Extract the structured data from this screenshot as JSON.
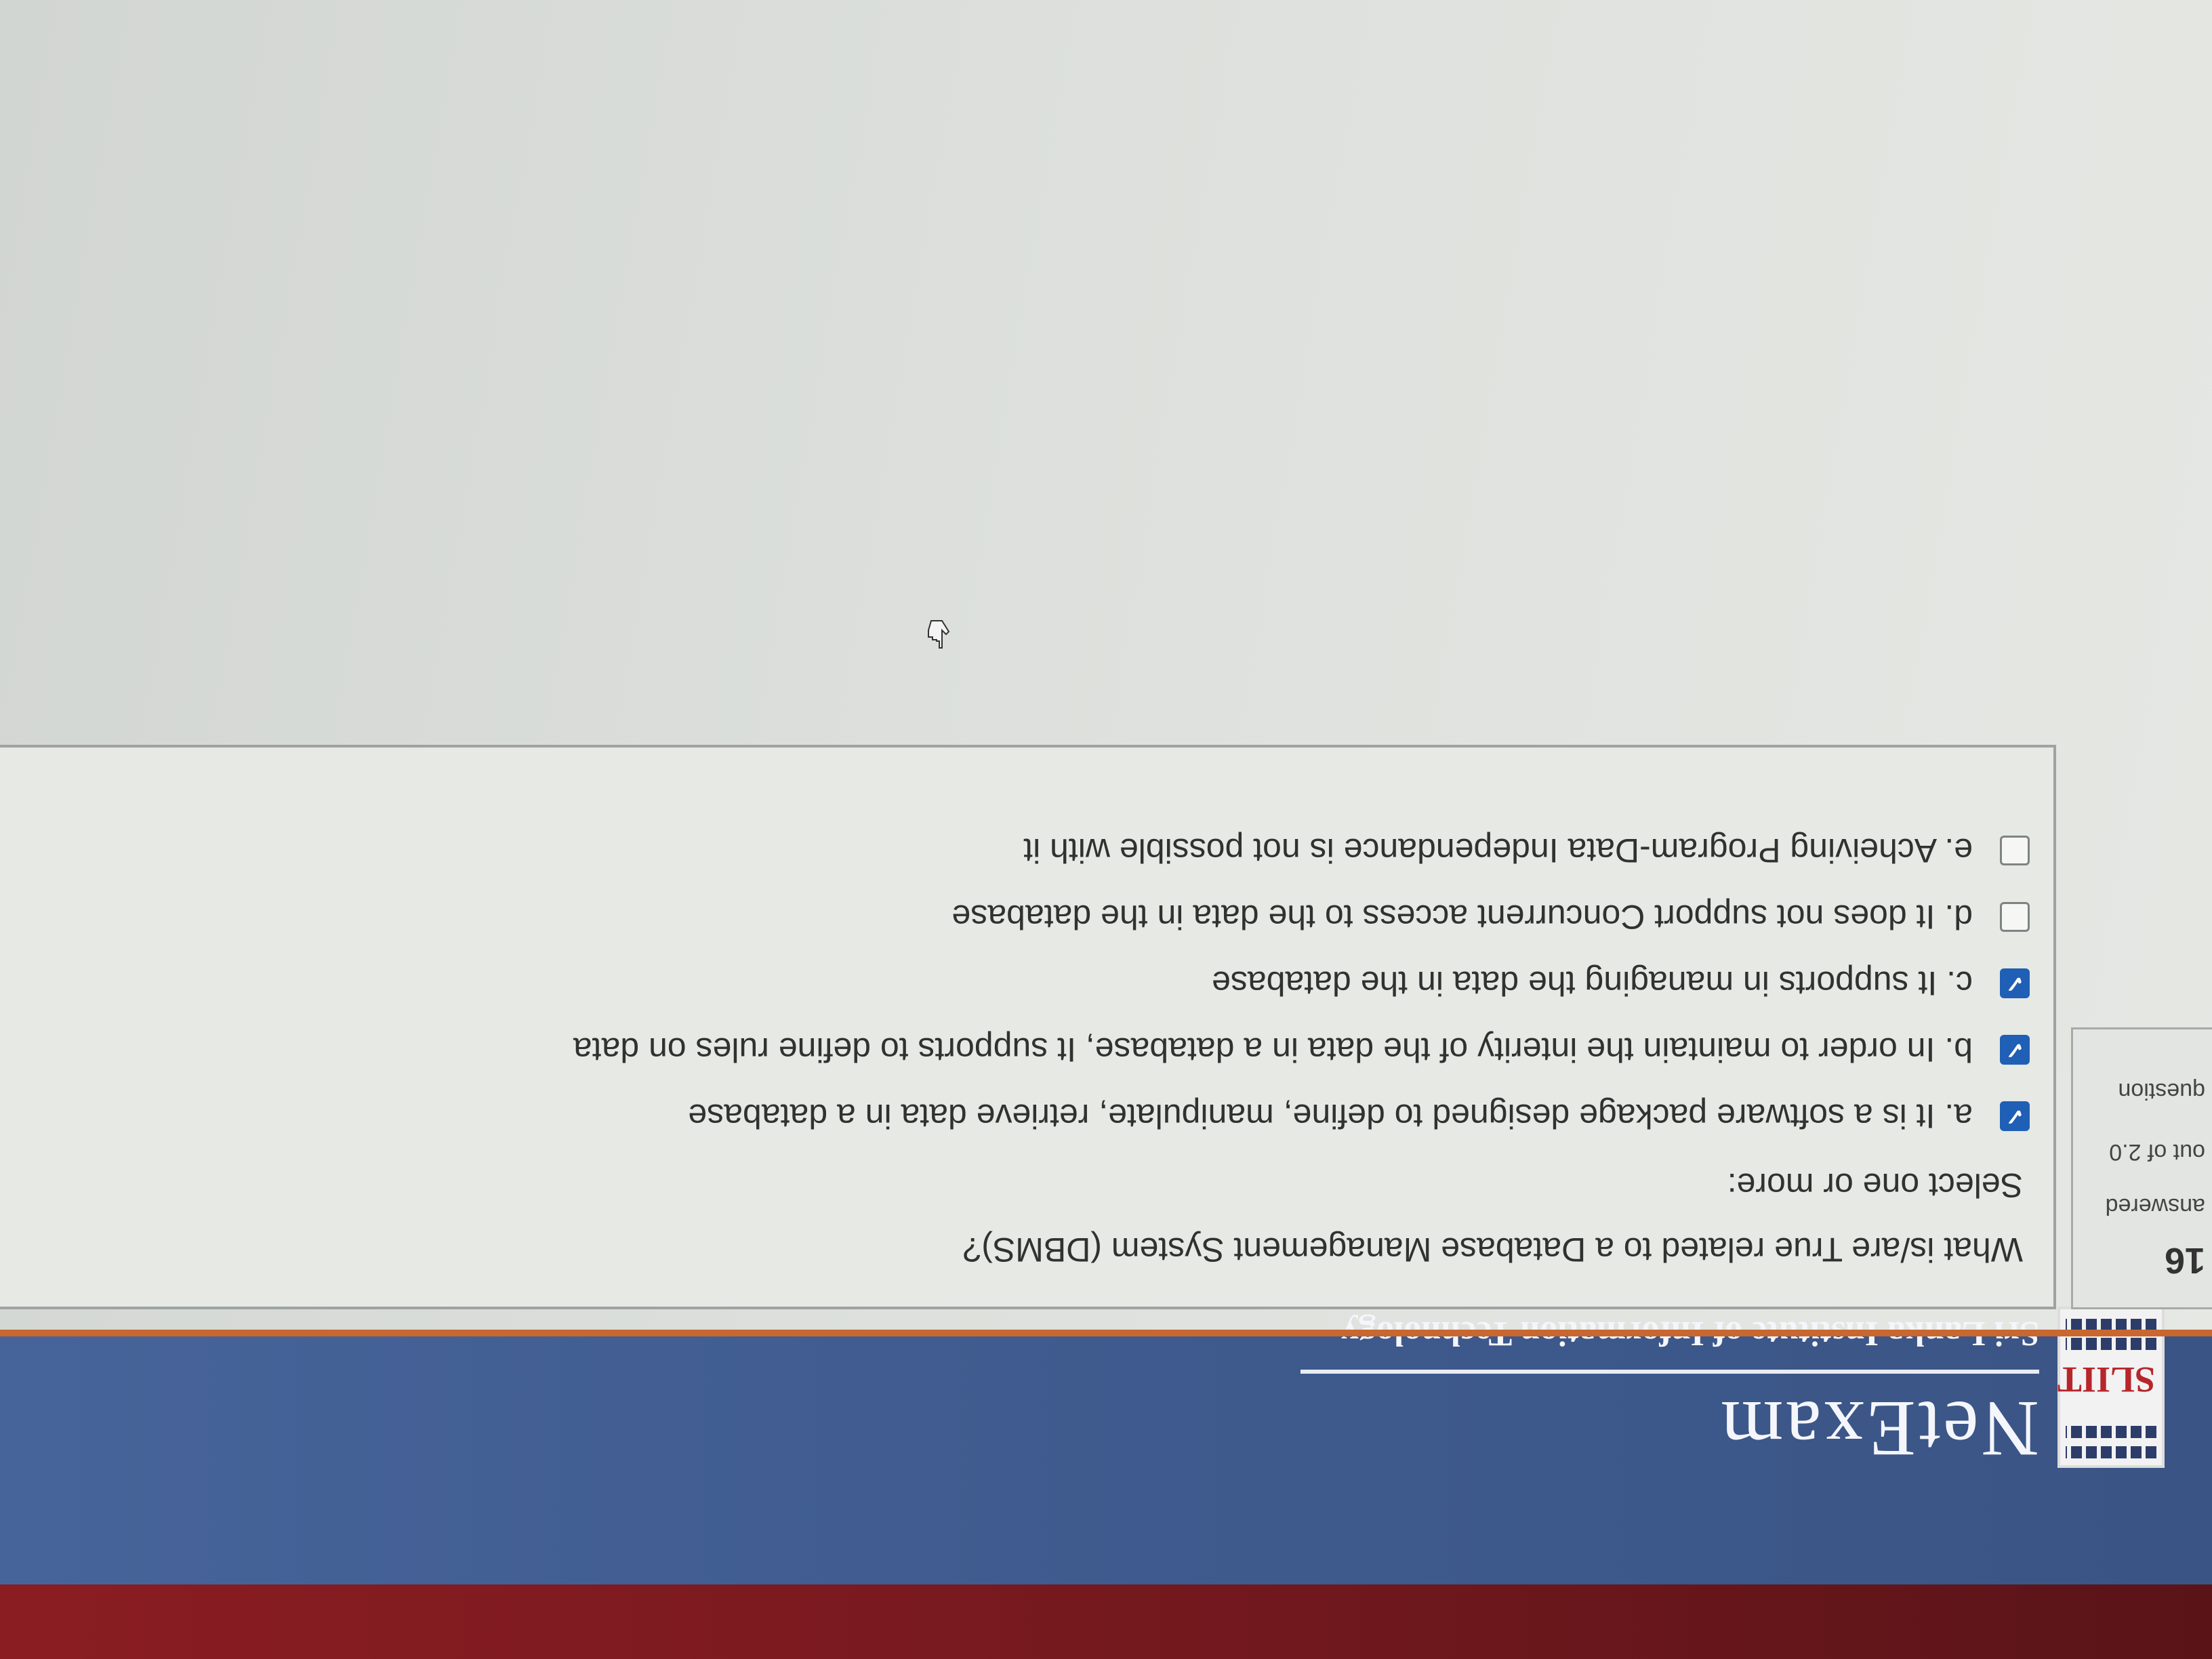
{
  "header": {
    "logo_text": "SLIIT",
    "title": "NetExam",
    "subtitle": "Sri Lanka Institute of Information Technology"
  },
  "question_info": {
    "number": "16",
    "status": "answered",
    "marks": "out of 2.0",
    "flag_label": "question"
  },
  "question": {
    "text": "What is/are True related to a Database Management System (DBMS)?",
    "prompt": "Select one or more:",
    "options": [
      {
        "label": "a. It is a software package designed to define, manipulate, retrieve data in a database",
        "checked": true
      },
      {
        "label": "b. In order to maintain the interity of the data in a database, It supports to define rules on data",
        "checked": true
      },
      {
        "label": "c. It supports in managing the data in the database",
        "checked": true
      },
      {
        "label": "d. It does not support Concurrent access to the data in the database",
        "checked": false
      },
      {
        "label": "e. Acheiving Program-Data Independance is not possible with it",
        "checked": false
      }
    ]
  },
  "colors": {
    "header_blue": "#405c90",
    "header_red": "#7a1a20",
    "accent_orange": "#c8672f",
    "checkbox_checked": "#1f5fb5"
  },
  "icons": {
    "checkbox_checked": "check-icon",
    "cursor": "hand-cursor-icon"
  }
}
